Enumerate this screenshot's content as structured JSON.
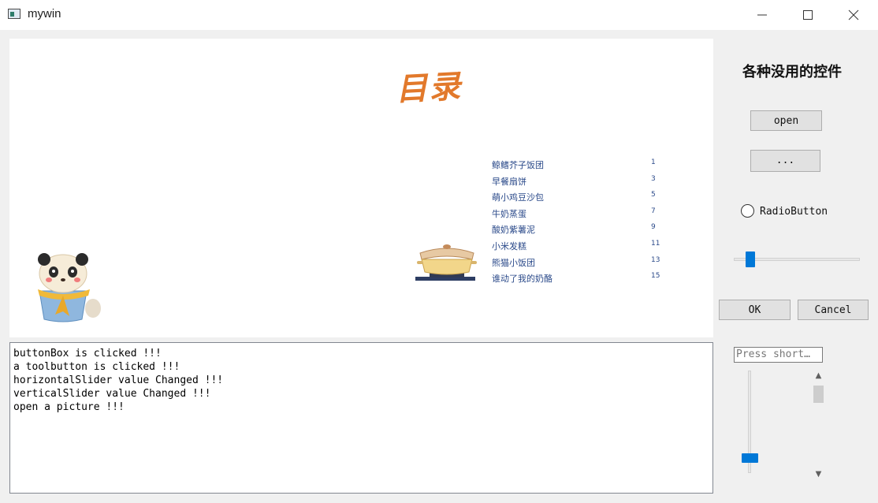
{
  "window": {
    "title": "mywin",
    "controls": [
      "minimize-icon",
      "maximize-icon",
      "close-icon"
    ]
  },
  "picture": {
    "menu_title": "目录",
    "menu_items": [
      {
        "name": "鲸鳍芥子饭团",
        "page": "1"
      },
      {
        "name": "早餐扇饼",
        "page": "3"
      },
      {
        "name": "萌小鸡豆沙包",
        "page": "5"
      },
      {
        "name": "牛奶蒸蛋",
        "page": "7"
      },
      {
        "name": "酸奶紫薯泥",
        "page": "9"
      },
      {
        "name": "小米发糕",
        "page": "11"
      },
      {
        "name": "熊猫小饭团",
        "page": "13"
      },
      {
        "name": "谁动了我的奶酪",
        "page": "15"
      }
    ]
  },
  "side_panel": {
    "title": "各种没用的控件",
    "open_button": "open",
    "tool_button": "...",
    "radio_label": "RadioButton",
    "radio_checked": false,
    "horizontal_slider_fraction": 0.1,
    "ok_button": "OK",
    "cancel_button": "Cancel",
    "shortcut_placeholder": "Press short…",
    "vertical_slider_fraction": 0.1
  },
  "log": {
    "lines": [
      "buttonBox is clicked !!!",
      "a toolbutton is clicked !!!",
      "horizontalSlider value Changed !!!",
      "verticalSlider value Changed !!!",
      "open a picture !!!"
    ]
  },
  "colors": {
    "accent": "#0078d7",
    "menu_title": "#e2792b",
    "menu_text": "#2b4a8a"
  }
}
